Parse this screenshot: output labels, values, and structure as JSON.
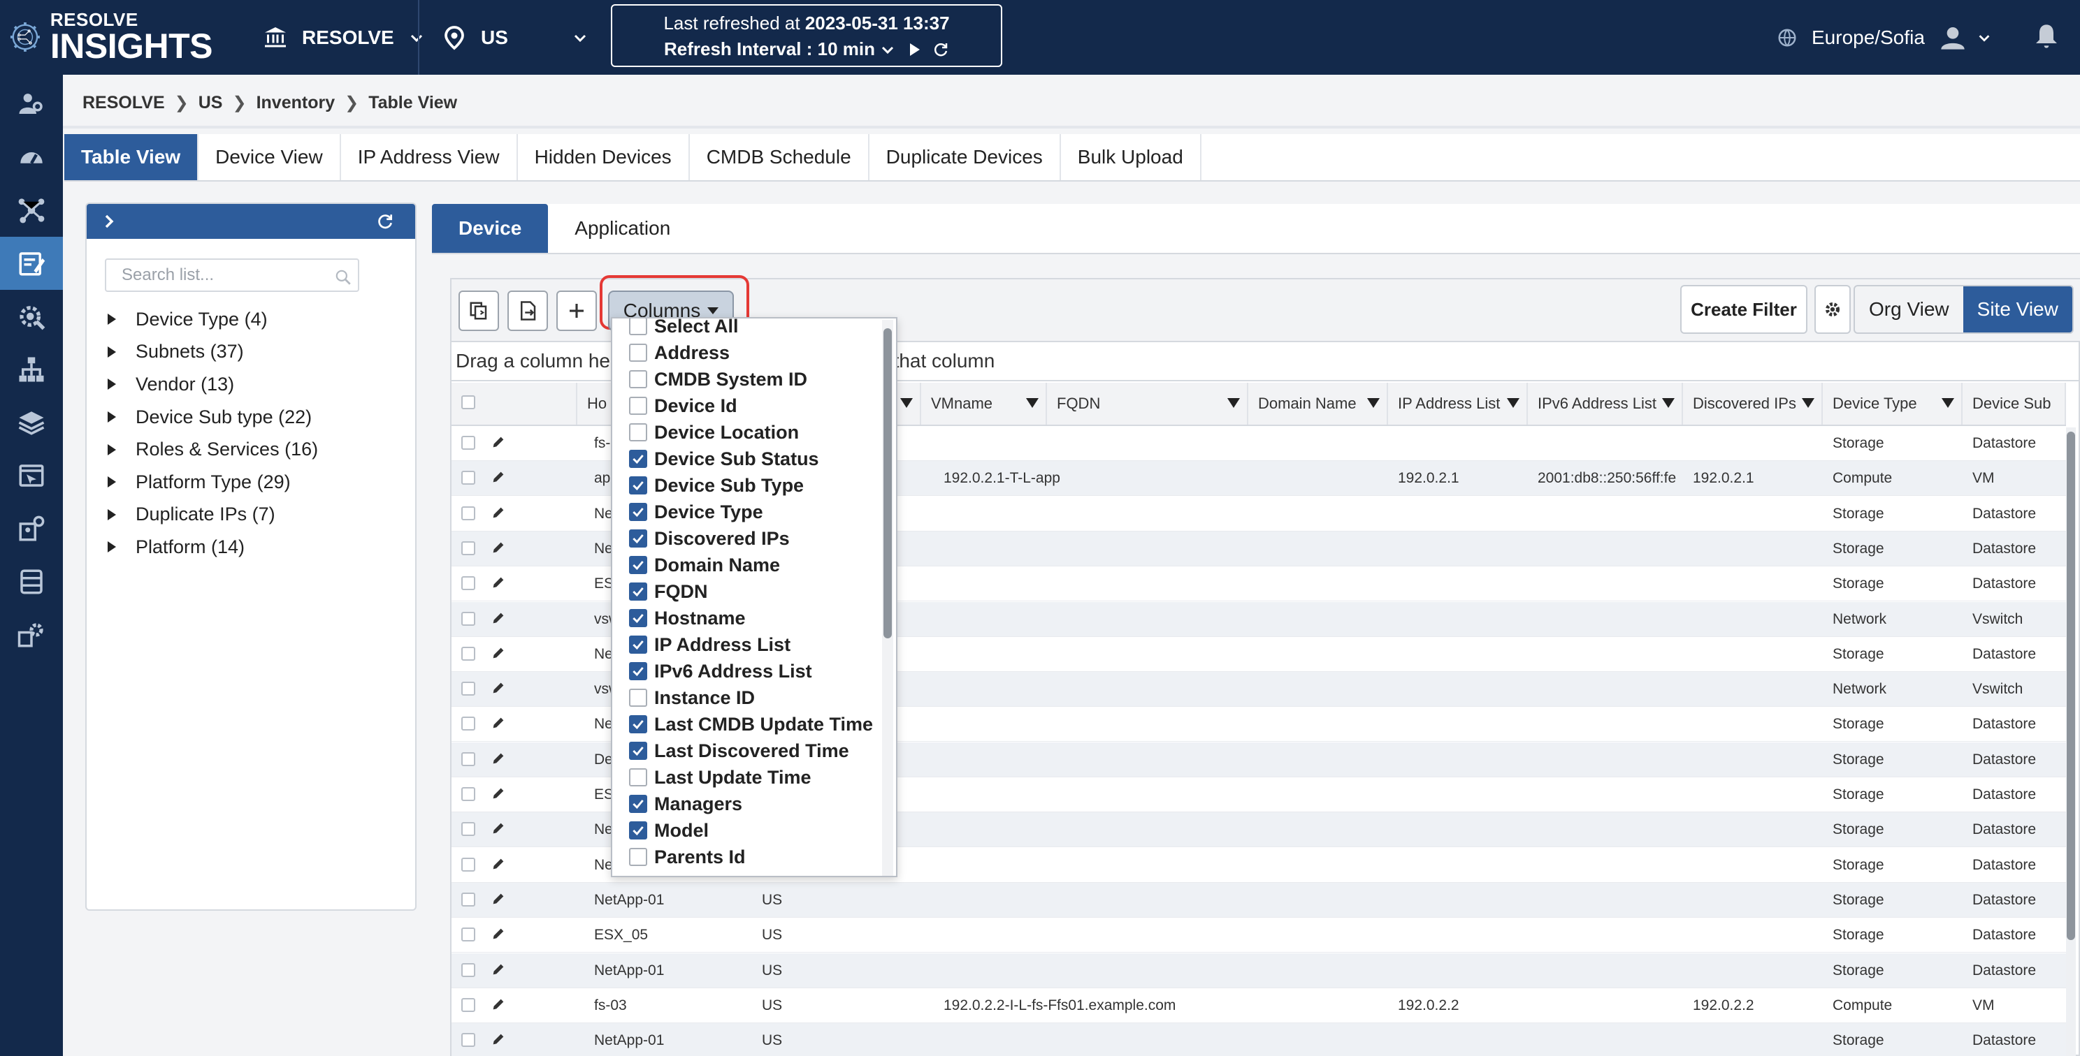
{
  "header": {
    "brand_line1": "RESOLVE",
    "brand_line2": "INSIGHTS",
    "org_selector": "RESOLVE",
    "region_selector": "US",
    "refresh_prefix": "Last refreshed at",
    "refresh_time": "2023-05-31 13:37",
    "refresh_interval": "Refresh Interval : 10 min",
    "timezone": "Europe/Sofia"
  },
  "breadcrumb": [
    "RESOLVE",
    "US",
    "Inventory",
    "Table View"
  ],
  "main_tabs": [
    "Table View",
    "Device View",
    "IP Address View",
    "Hidden Devices",
    "CMDB Schedule",
    "Duplicate Devices",
    "Bulk Upload"
  ],
  "filter_panel": {
    "search_placeholder": "Search list...",
    "tree": [
      "Device Type (4)",
      "Subnets (37)",
      "Vendor (13)",
      "Device Sub type (22)",
      "Roles & Services (16)",
      "Platform Type (29)",
      "Duplicate IPs (7)",
      "Platform (14)"
    ]
  },
  "sub_tabs": [
    "Device",
    "Application"
  ],
  "toolbar": {
    "columns_label": "Columns",
    "create_filter": "Create Filter",
    "org_view": "Org View",
    "site_view": "Site View"
  },
  "group_hint_left": "Drag a column hea",
  "group_hint_right": "that column",
  "columns_menu": [
    {
      "label": "Select All",
      "checked": false
    },
    {
      "label": "Address",
      "checked": false
    },
    {
      "label": "CMDB System ID",
      "checked": false
    },
    {
      "label": "Device Id",
      "checked": false
    },
    {
      "label": "Device Location",
      "checked": false
    },
    {
      "label": "Device Sub Status",
      "checked": true
    },
    {
      "label": "Device Sub Type",
      "checked": true
    },
    {
      "label": "Device Type",
      "checked": true
    },
    {
      "label": "Discovered IPs",
      "checked": true
    },
    {
      "label": "Domain Name",
      "checked": true
    },
    {
      "label": "FQDN",
      "checked": true
    },
    {
      "label": "Hostname",
      "checked": true
    },
    {
      "label": "IP Address List",
      "checked": true
    },
    {
      "label": "IPv6 Address List",
      "checked": true
    },
    {
      "label": "Instance ID",
      "checked": false
    },
    {
      "label": "Last CMDB Update Time",
      "checked": true
    },
    {
      "label": "Last Discovered Time",
      "checked": true
    },
    {
      "label": "Last Update Time",
      "checked": false
    },
    {
      "label": "Managers",
      "checked": true
    },
    {
      "label": "Model",
      "checked": true
    },
    {
      "label": "Parents Id",
      "checked": false
    }
  ],
  "table": {
    "headers": [
      "Ho",
      "",
      "VMname",
      "FQDN",
      "Domain Name",
      "IP Address List",
      "IPv6 Address List",
      "Discovered IPs",
      "Device Type",
      "Device Sub"
    ],
    "rows": [
      [
        "fs-c",
        "",
        "",
        "",
        "",
        "",
        "",
        "",
        "Storage",
        "Datastore"
      ],
      [
        "app",
        "",
        "192.0.2.1-T-L-app",
        "",
        "",
        "192.0.2.1",
        "2001:db8::250:56ff:fe",
        "192.0.2.1",
        "Compute",
        "VM"
      ],
      [
        "Net",
        "",
        "",
        "",
        "",
        "",
        "",
        "",
        "Storage",
        "Datastore"
      ],
      [
        "Net",
        "",
        "",
        "",
        "",
        "",
        "",
        "",
        "Storage",
        "Datastore"
      ],
      [
        "ESX",
        "",
        "",
        "",
        "",
        "",
        "",
        "",
        "Storage",
        "Datastore"
      ],
      [
        "vsw",
        "",
        "",
        "",
        "",
        "",
        "",
        "",
        "Network",
        "Vswitch"
      ],
      [
        "Net",
        "",
        "",
        "",
        "",
        "",
        "",
        "",
        "Storage",
        "Datastore"
      ],
      [
        "vsw",
        "",
        "",
        "",
        "",
        "",
        "",
        "",
        "Network",
        "Vswitch"
      ],
      [
        "Net",
        "",
        "",
        "",
        "",
        "",
        "",
        "",
        "Storage",
        "Datastore"
      ],
      [
        "Dell",
        "",
        "",
        "",
        "",
        "",
        "",
        "",
        "Storage",
        "Datastore"
      ],
      [
        "ESX",
        "",
        "",
        "",
        "",
        "",
        "",
        "",
        "Storage",
        "Datastore"
      ],
      [
        "Net",
        "",
        "",
        "",
        "",
        "",
        "",
        "",
        "Storage",
        "Datastore"
      ],
      [
        "Net",
        "",
        "",
        "",
        "",
        "",
        "",
        "",
        "Storage",
        "Datastore"
      ],
      [
        "NetApp-01",
        "US",
        "",
        "",
        "",
        "",
        "",
        "",
        "Storage",
        "Datastore"
      ],
      [
        "ESX_05",
        "US",
        "",
        "",
        "",
        "",
        "",
        "",
        "Storage",
        "Datastore"
      ],
      [
        "NetApp-01",
        "US",
        "",
        "",
        "",
        "",
        "",
        "",
        "Storage",
        "Datastore"
      ],
      [
        "fs-03",
        "US",
        "192.0.2.2-I-L-fs-F",
        "fs01.example.com",
        "",
        "192.0.2.2",
        "",
        "192.0.2.2",
        "Compute",
        "VM"
      ],
      [
        "NetApp-01",
        "US",
        "",
        "",
        "",
        "",
        "",
        "",
        "Storage",
        "Datastore"
      ]
    ]
  }
}
